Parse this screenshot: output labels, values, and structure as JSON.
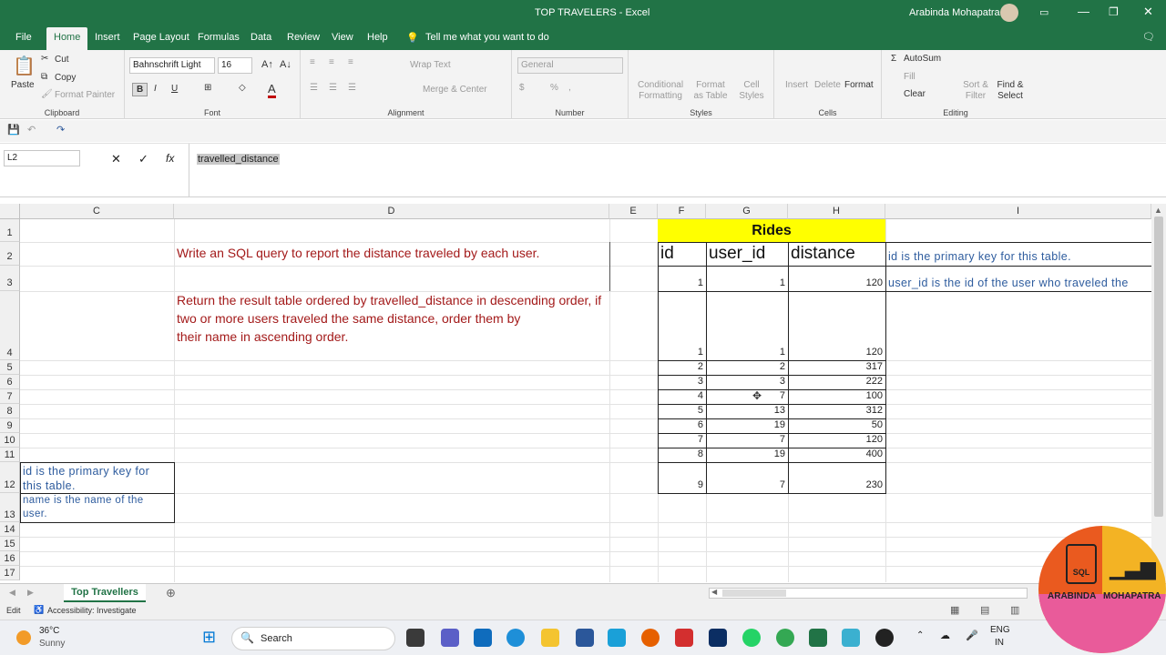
{
  "window": {
    "title": "TOP TRAVELERS  -  Excel",
    "user": "Arabinda Mohapatra"
  },
  "menu": [
    "File",
    "Home",
    "Insert",
    "Page Layout",
    "Formulas",
    "Data",
    "Review",
    "View",
    "Help"
  ],
  "tell_me": "Tell me what you want to do",
  "ribbon": {
    "clipboard": {
      "paste": "Paste",
      "cut": "Cut",
      "copy": "Copy",
      "format_painter": "Format Painter",
      "label": "Clipboard"
    },
    "font": {
      "name": "Bahnschrift Light",
      "size": "16",
      "label": "Font",
      "bold": "B",
      "italic": "I",
      "underline": "U"
    },
    "alignment": {
      "wrap": "Wrap Text",
      "merge": "Merge & Center",
      "label": "Alignment"
    },
    "number": {
      "format": "General",
      "label": "Number"
    },
    "styles": {
      "conditional": "Conditional Formatting",
      "format_table": "Format as Table",
      "cell_styles": "Cell Styles",
      "label": "Styles"
    },
    "cells": {
      "insert": "Insert",
      "delete": "Delete",
      "format": "Format",
      "label": "Cells"
    },
    "editing": {
      "autosum": "AutoSum",
      "fill": "Fill",
      "clear": "Clear",
      "sort": "Sort & Filter",
      "find": "Find & Select",
      "label": "Editing"
    }
  },
  "formula_bar": {
    "name_box": "L2",
    "fx": "fx",
    "content": "travelled_distance"
  },
  "columns": [
    "C",
    "D",
    "E",
    "F",
    "G",
    "H",
    "I"
  ],
  "rows": [
    "1",
    "2",
    "3",
    "4",
    "5",
    "6",
    "7",
    "8",
    "9",
    "10",
    "11",
    "12",
    "13",
    "14",
    "15",
    "16",
    "17"
  ],
  "sheet": {
    "rides_title": "Rides",
    "headers": {
      "id": "id",
      "user_id": "user_id",
      "distance": "distance"
    },
    "top_row": {
      "id": "1",
      "user_id": "1",
      "distance": "120"
    },
    "rides": [
      {
        "id": "1",
        "user_id": "1",
        "distance": "120"
      },
      {
        "id": "2",
        "user_id": "2",
        "distance": "317"
      },
      {
        "id": "3",
        "user_id": "3",
        "distance": "222"
      },
      {
        "id": "4",
        "user_id": "7",
        "distance": "100"
      },
      {
        "id": "5",
        "user_id": "13",
        "distance": "312"
      },
      {
        "id": "6",
        "user_id": "19",
        "distance": "50"
      },
      {
        "id": "7",
        "user_id": "7",
        "distance": "120"
      },
      {
        "id": "8",
        "user_id": "19",
        "distance": "400"
      },
      {
        "id": "9",
        "user_id": "7",
        "distance": "230"
      }
    ],
    "question1": "Write an SQL query to report the distance traveled by each user.",
    "question2_lines": [
      "Return the result table ordered by travelled_distance in descending order, if",
      "two or more users traveled the same distance, order them by",
      "their name in ascending order."
    ],
    "note_i2": "id is the primary key for this table.",
    "note_i3": "user_id is the id of the user who traveled the",
    "note_c12_lines": [
      "id is the primary key for",
      "this table."
    ],
    "note_c13_lines": [
      "name is the name of the",
      "user."
    ]
  },
  "sheet_tab": "Top Travellers",
  "status": {
    "mode": "Edit",
    "accessibility": "Accessibility: Investigate"
  },
  "taskbar": {
    "temp": "36°C",
    "weather": "Sunny",
    "search": "Search",
    "lang1": "ENG",
    "lang2": "IN"
  },
  "watermark": {
    "left": "ARABINDA",
    "right": "MOHAPATRA",
    "badge": "SQL"
  },
  "colors": {
    "excel_green": "#217346",
    "rides_header": "#ffff00",
    "question": "#a31a1a",
    "note": "#2e5c9e"
  }
}
